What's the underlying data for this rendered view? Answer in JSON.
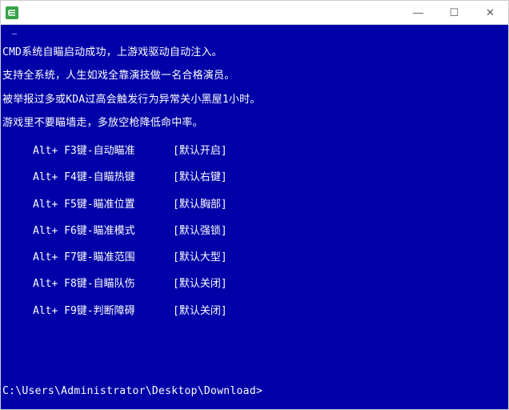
{
  "window": {
    "title": ""
  },
  "controls": {
    "minimize": "—",
    "maximize": "☐",
    "close": "✕"
  },
  "terminal": {
    "top_token": "—",
    "messages": [
      "CMD系统自瞄启动成功，上游戏驱动自动注入。",
      "支持全系统，人生如戏全靠演技做一名合格演员。",
      "被举报过多或KDA过高会触发行为异常关小黑屋1小时。",
      "游戏里不要瞄墙走，多放空枪降低命中率。"
    ],
    "hotkeys": [
      {
        "key": "Alt+ F3键-自动瞄准",
        "def": "[默认开启]"
      },
      {
        "key": "Alt+ F4键-自瞄热键",
        "def": "[默认右键]"
      },
      {
        "key": "Alt+ F5键-瞄准位置",
        "def": "[默认胸部]"
      },
      {
        "key": "Alt+ F6键-瞄准模式",
        "def": "[默认强锁]"
      },
      {
        "key": "Alt+ F7键-瞄准范围",
        "def": "[默认大型]"
      },
      {
        "key": "Alt+ F8键-自瞄队伤",
        "def": "[默认关闭]"
      },
      {
        "key": "Alt+ F9键-判断障碍",
        "def": "[默认关闭]"
      }
    ],
    "prompt": "C:\\Users\\Administrator\\Desktop\\Download>"
  },
  "colors": {
    "terminal_bg": "#0000A8",
    "terminal_fg": "#FFFFFF",
    "titlebar_bg": "#FFFFFF",
    "icon_green": "#36A24A"
  }
}
